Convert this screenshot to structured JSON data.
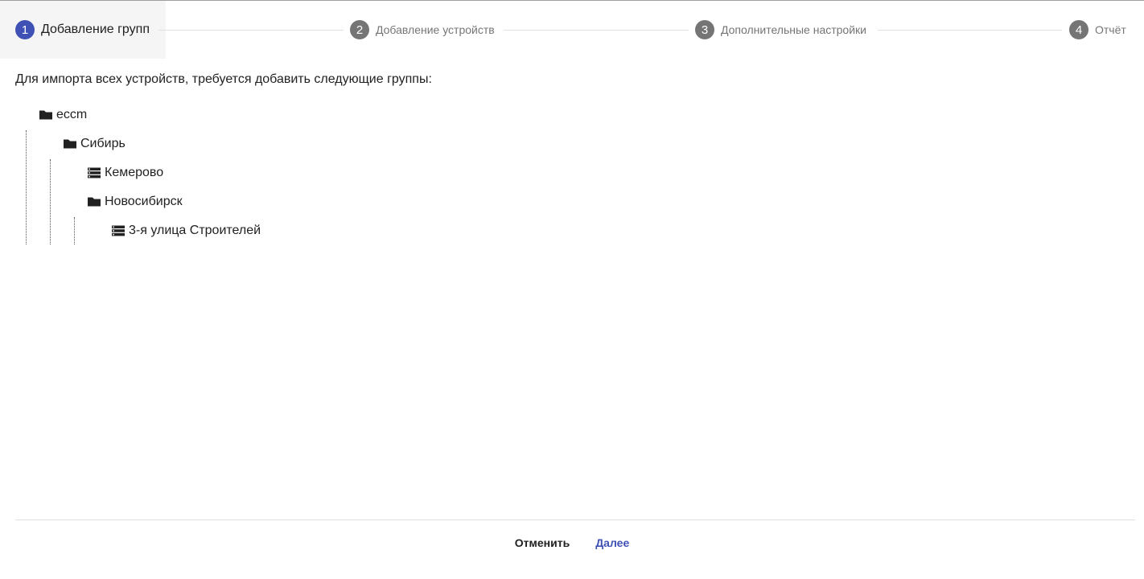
{
  "stepper": {
    "steps": [
      {
        "number": "1",
        "label": "Добавление групп",
        "active": true
      },
      {
        "number": "2",
        "label": "Добавление устройств",
        "active": false
      },
      {
        "number": "3",
        "label": "Дополнительные настройки",
        "active": false
      },
      {
        "number": "4",
        "label": "Отчёт",
        "active": false
      }
    ]
  },
  "main": {
    "intro": "Для импорта всех устройств, требуется добавить следующие группы:",
    "tree": [
      {
        "label": "eccm",
        "icon": "folder-icon",
        "level": 0
      },
      {
        "label": "Сибирь",
        "icon": "folder-icon",
        "level": 1
      },
      {
        "label": "Кемерово",
        "icon": "server-icon",
        "level": 2
      },
      {
        "label": "Новосибирск",
        "icon": "folder-icon",
        "level": 2
      },
      {
        "label": "3-я улица Строителей",
        "icon": "server-icon",
        "level": 3
      }
    ]
  },
  "footer": {
    "cancel_label": "Отменить",
    "next_label": "Далее"
  },
  "colors": {
    "accent": "#3f51b5",
    "inactive": "#757575",
    "active_step_bg": "#f5f5f5"
  }
}
